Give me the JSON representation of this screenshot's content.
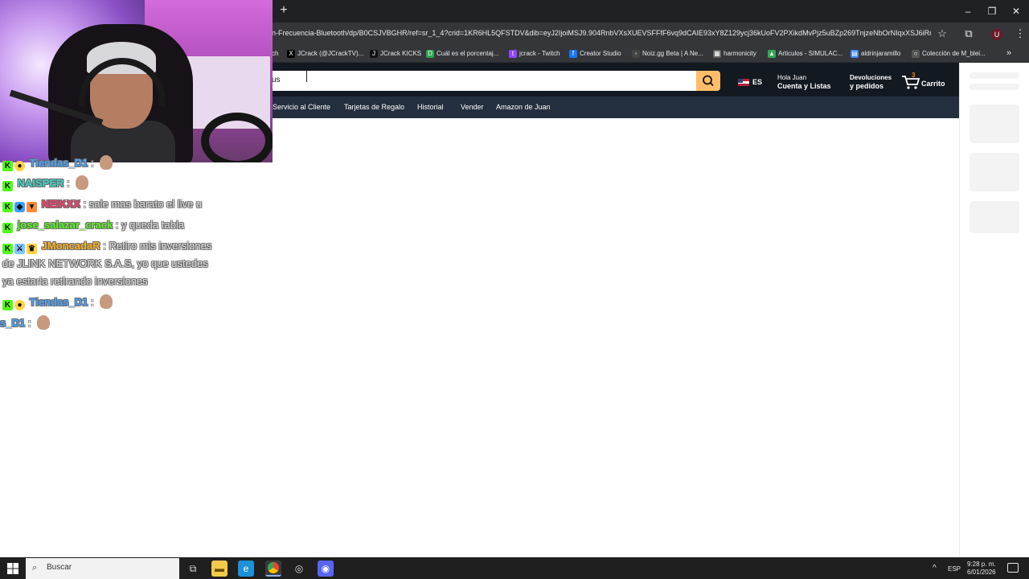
{
  "browser": {
    "new_tab_label": "+",
    "url": "n-Frecuencia-Bluetooth/dp/B0CSJVBGHR/ref=sr_1_4?crid=1KR6HL5QFSTDV&dib=eyJ2IjoiMSJ9.904RnbVXsXUEVSFFfF6vq9dCAIE93xY8Z129ycj36kUoFV2PXikdMvPjz5uBZp269TnjzeNbOrNIqxXSJ6iRrZ...",
    "window_controls": {
      "minimize": "–",
      "restore": "❐",
      "close": "✕"
    },
    "toolbar_icons": [
      "star-icon",
      "extensions-icon",
      "profile-icon",
      "menu-icon"
    ],
    "bookmarks": [
      {
        "label": "ch",
        "icon": ""
      },
      {
        "label": "JCrack (@JCrackTV)...",
        "icon": "X"
      },
      {
        "label": "JCrack KICKS",
        "icon": "J"
      },
      {
        "label": "Cuál es el porcentaj...",
        "icon": "D"
      },
      {
        "label": "jcrack - Twitch",
        "icon": "t"
      },
      {
        "label": "Creator Studio",
        "icon": "f"
      },
      {
        "label": "Noiz.gg Beta | A Ne...",
        "icon": "◦"
      },
      {
        "label": "harmonicity",
        "icon": "▦"
      },
      {
        "label": "Articulos - SIMULAC...",
        "icon": "▲"
      },
      {
        "label": "aldrinjaramillo",
        "icon": "▤"
      },
      {
        "label": "Colección de M_blei...",
        "icon": "○"
      }
    ],
    "bookmarks_more": "»"
  },
  "amazon": {
    "search_value": "us",
    "language": "ES",
    "account": {
      "line1": "Hola Juan",
      "line2": "Cuenta y Listas"
    },
    "orders": {
      "line1": "Devoluciones",
      "line2": "y pedidos"
    },
    "cart": {
      "count": "3",
      "label": "Carrito"
    },
    "nav": [
      "Servicio al Cliente",
      "Tarjetas de Regalo",
      "Historial",
      "Vender",
      "Amazon de Juan"
    ]
  },
  "chat": [
    {
      "name": "Tiendas_D1",
      "name_color": "#4aa3ff",
      "badges": [
        "kick",
        "coin"
      ],
      "message": "",
      "emote": true
    },
    {
      "name": "NAISPER",
      "name_color": "#3fd4c8",
      "badges": [
        "kick"
      ],
      "message": "",
      "emote": true
    },
    {
      "name": "NEIKXX",
      "name_color": "#ff3b6b",
      "badges": [
        "kick",
        "gem",
        "shield"
      ],
      "message": "sale mas barato el live u",
      "emote": false
    },
    {
      "name": "jose_salazar_crack",
      "name_color": "#53fc18",
      "badges": [
        "kick"
      ],
      "message": "y queda tabla",
      "emote": false
    },
    {
      "name": "JMoncadaR",
      "name_color": "#ffb020",
      "badges": [
        "kick",
        "sword",
        "crown"
      ],
      "message": "Retiro mis inversiones",
      "message_cont": [
        "de JLINK NETWORK S.A.S, yo que ustedes",
        "ya estaria retirando inversiones"
      ],
      "emote": false
    },
    {
      "name": "Tiendas_D1",
      "name_color": "#4aa3ff",
      "badges": [
        "kick",
        "coin"
      ],
      "message": "",
      "emote": true
    },
    {
      "name": "s_D1",
      "name_color": "#4aa3ff",
      "badges": [],
      "message": "",
      "emote": true
    }
  ],
  "taskbar": {
    "search_placeholder": "Buscar",
    "language": "ESP",
    "time": "9:28 p. m.",
    "date": "6/01/2026",
    "up_arrow": "^"
  }
}
